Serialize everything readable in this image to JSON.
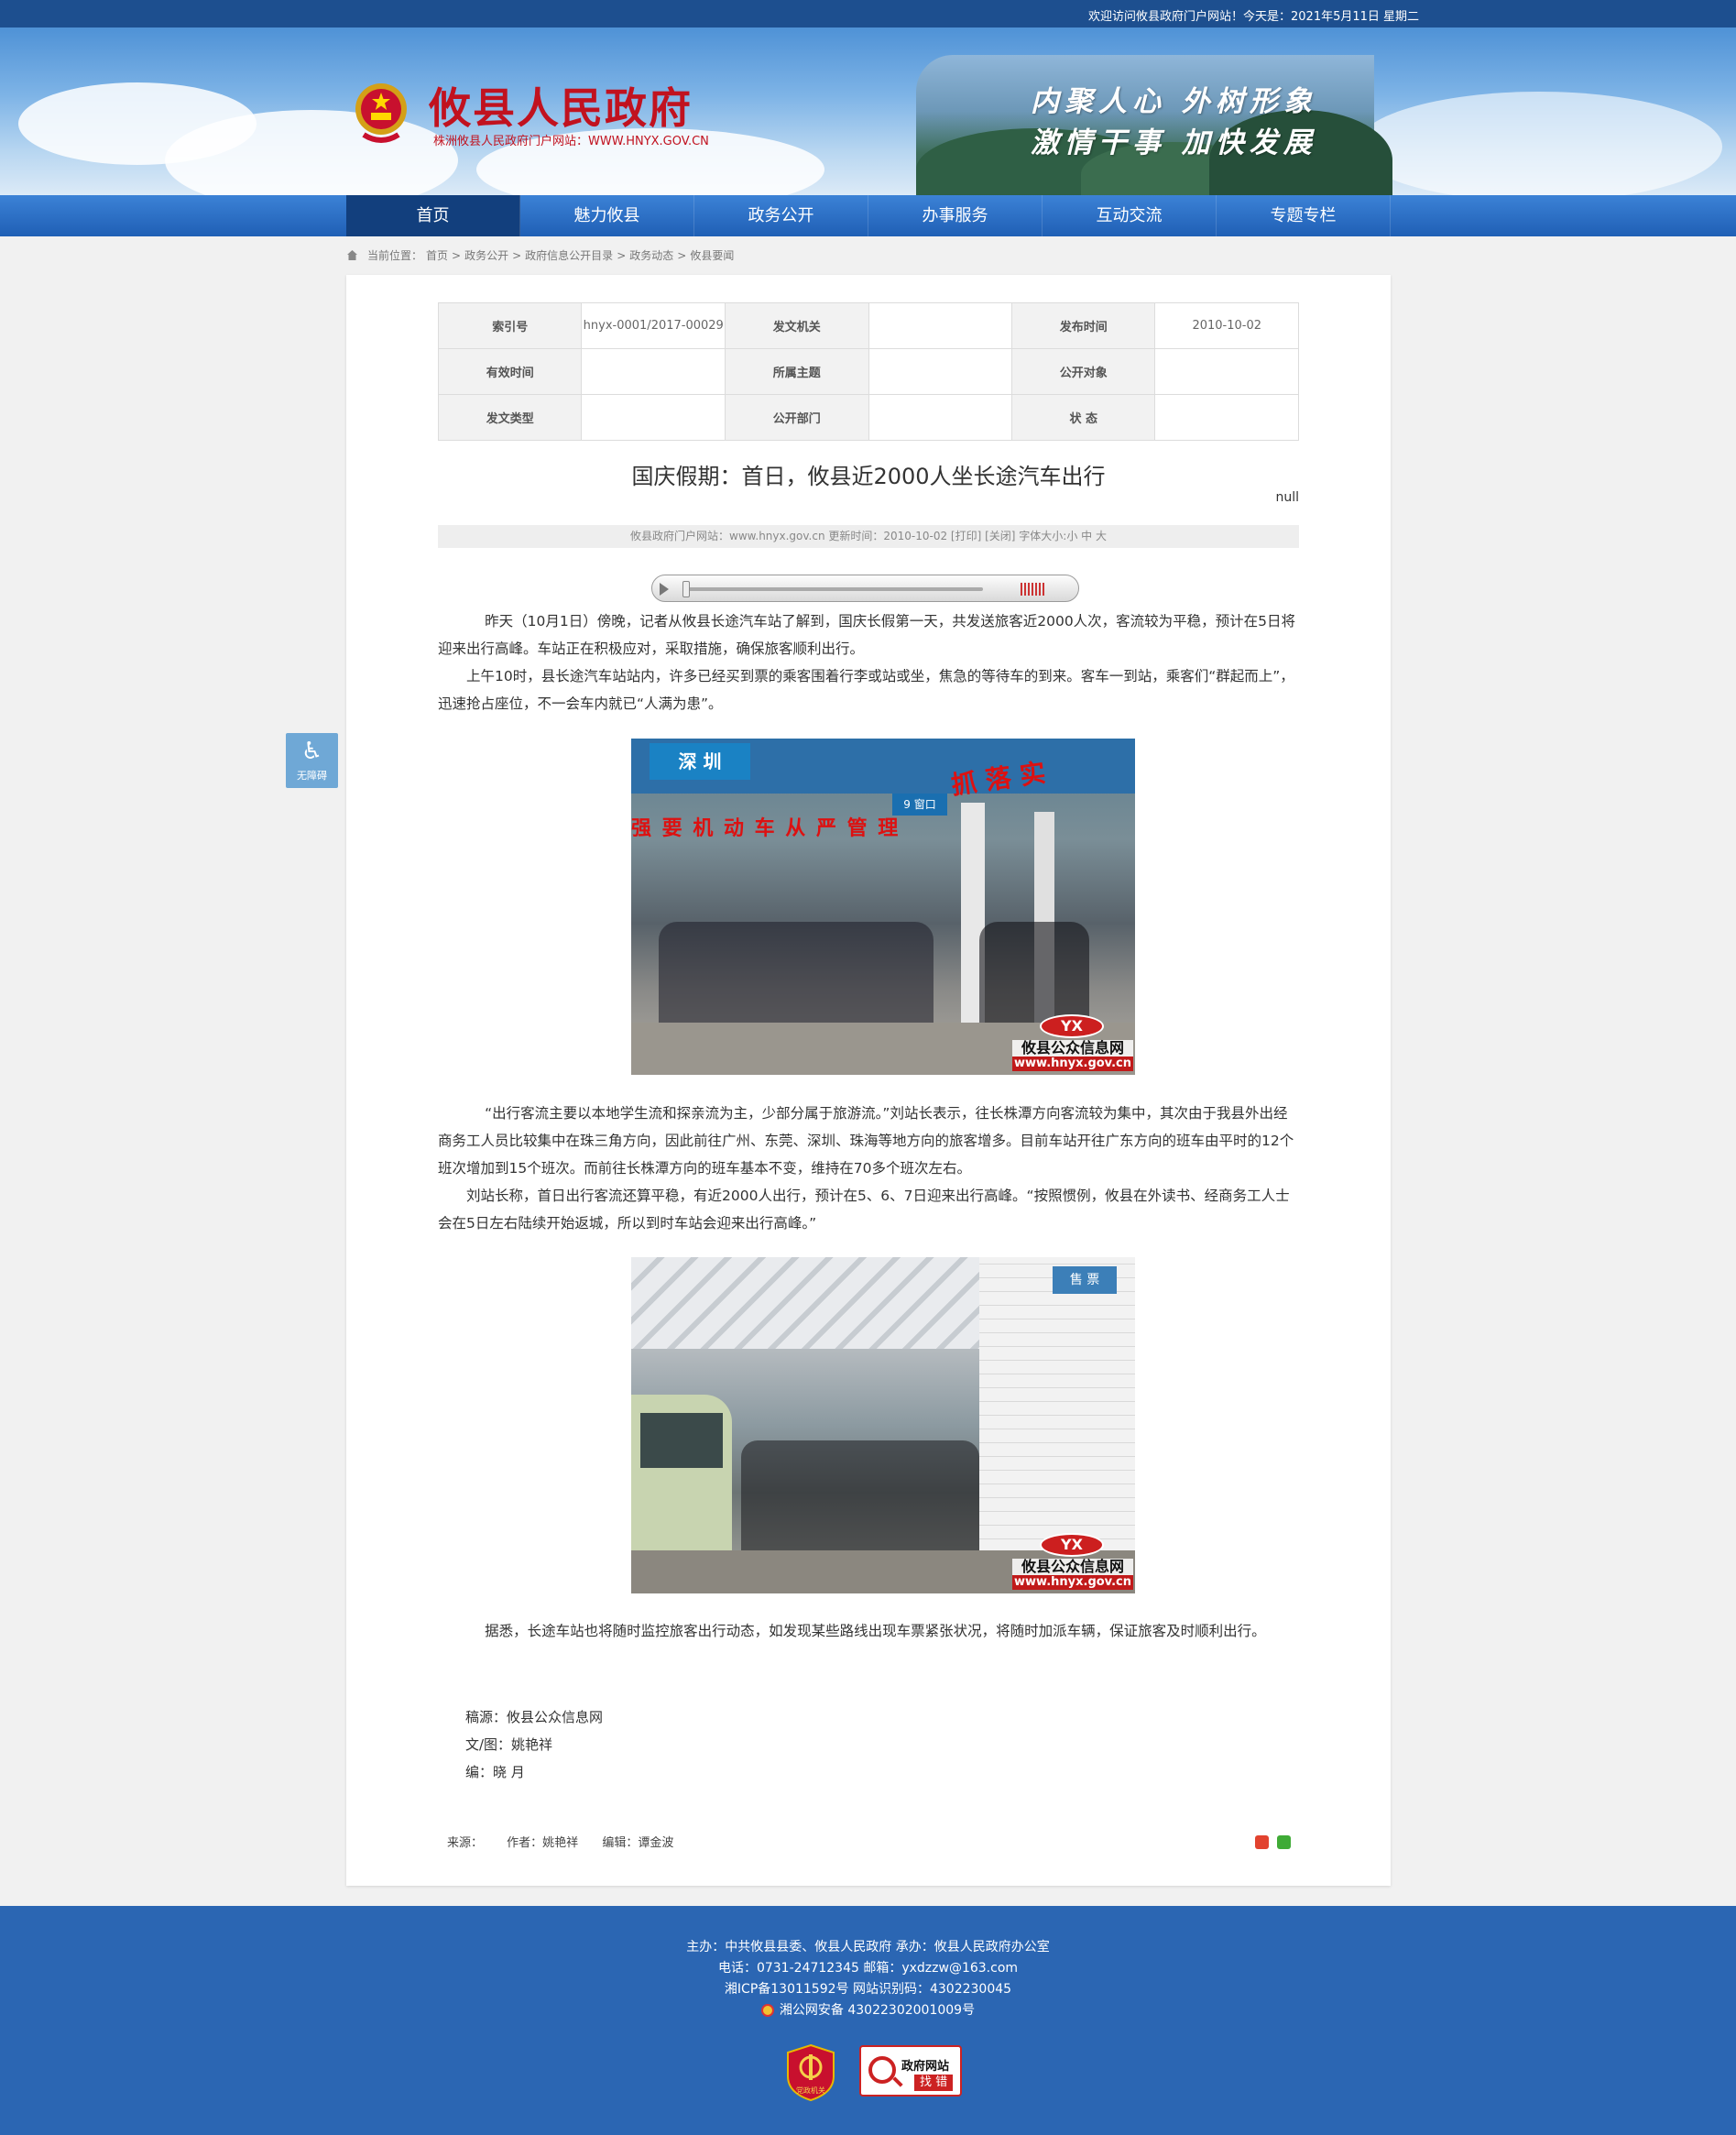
{
  "topbar": {
    "welcome": "欢迎访问攸县政府门户网站！今天是：2021年5月11日 星期二"
  },
  "header": {
    "site_title": "攸县人民政府",
    "site_url": "株洲攸县人民政府门户网站：WWW.HNYX.GOV.CN",
    "slogan_line1": "内聚人心  外树形象",
    "slogan_line2": "激情干事  加快发展"
  },
  "nav": {
    "items": [
      {
        "label": "首页"
      },
      {
        "label": "魅力攸县"
      },
      {
        "label": "政务公开"
      },
      {
        "label": "办事服务"
      },
      {
        "label": "互动交流"
      },
      {
        "label": "专题专栏"
      }
    ]
  },
  "breadcrumb": {
    "prefix": "当前位置：",
    "items": [
      "首页",
      "政务公开",
      "政府信息公开目录",
      "政务动态",
      "攸县要闻"
    ],
    "separator": ">"
  },
  "meta": {
    "rows": [
      [
        {
          "label": "索引号",
          "value": "hnyx-0001/2017-00029"
        },
        {
          "label": "发文机关",
          "value": ""
        },
        {
          "label": "发布时间",
          "value": "2010-10-02"
        }
      ],
      [
        {
          "label": "有效时间",
          "value": ""
        },
        {
          "label": "所属主题",
          "value": ""
        },
        {
          "label": "公开对象",
          "value": ""
        }
      ],
      [
        {
          "label": "发文类型",
          "value": ""
        },
        {
          "label": "公开部门",
          "value": ""
        },
        {
          "label": "状 态",
          "value": ""
        }
      ]
    ]
  },
  "article": {
    "title": "国庆假期：首日，攸县近2000人坐长途汽车出行",
    "null_text": "null",
    "info_bar": "攸县政府门户网站：www.hnyx.gov.cn  更新时间：2010-10-02  [打印] [关闭]  字体大小:小 中 大",
    "paragraphs": [
      "昨天（10月1日）傍晚，记者从攸县长途汽车站了解到，国庆长假第一天，共发送旅客近2000人次，客流较为平稳，预计在5日将迎来出行高峰。车站正在积极应对，采取措施，确保旅客顺利出行。",
      "上午10时，县长途汽车站站内，许多已经买到票的乘客围着行李或站或坐，焦急的等待车的到来。客车一到站，乘客们“群起而上”，迅速抢占座位，不一会车内就已“人满为患”。",
      "“出行客流主要以本地学生流和探亲流为主，少部分属于旅游流。”刘站长表示，往长株潭方向客流较为集中，其次由于我县外出经商务工人员比较集中在珠三角方向，因此前往广州、东莞、深圳、珠海等地方向的旅客增多。目前车站开往广东方向的班车由平时的12个班次增加到15个班次。而前往长株潭方向的班车基本不变，维持在70多个班次左右。",
      "刘站长称，首日出行客流还算平稳，有近2000人出行，预计在5、6、7日迎来出行高峰。“按照惯例，攸县在外读书、经商务工人士会在5日左右陆续开始返城，所以到时车站会迎来出行高峰。”",
      "据悉，长途车站也将随时监控旅客出行动态，如发现某些路线出现车票紧张状况，将随时加派车辆，保证旅客及时顺利出行。"
    ],
    "photo_watermark": {
      "logo": "YX",
      "name": "攸县公众信息网",
      "url": "www.hnyx.gov.cn"
    },
    "photo1_signs": {
      "sign_left": "深 圳",
      "sign_top": "抓 落 实",
      "sign_mid": "强 要 机 动 车 从 严 管 理",
      "sign_gate": "9 窗口"
    },
    "photo2_signs": {
      "sign_right": "售 票"
    },
    "credits": [
      "稿源：攸县公众信息网",
      "文/图：姚艳祥",
      "编：晓   月"
    ]
  },
  "article_footer": {
    "source": "来源：",
    "author": "作者：姚艳祥",
    "editor": "编辑：谭金波"
  },
  "accessibility": {
    "label": "无障碍"
  },
  "footer": {
    "line1": "主办：中共攸县县委、攸县人民政府 承办：攸县人民政府办公室",
    "line2": "电话：0731-24712345 邮箱：yxdzzw@163.com",
    "line3": "湘ICP备13011592号   网站识别码：4302230045",
    "line4": "湘公网安备 43022302001009号",
    "badge1": "党政机关",
    "badge2_line1": "政府网站",
    "badge2_line2": "找 错"
  },
  "colors": {
    "nav_blue": "#2f6fc6",
    "nav_active": "#123f7d",
    "title_red": "#c1121f",
    "footer_blue": "#2b66b3"
  }
}
